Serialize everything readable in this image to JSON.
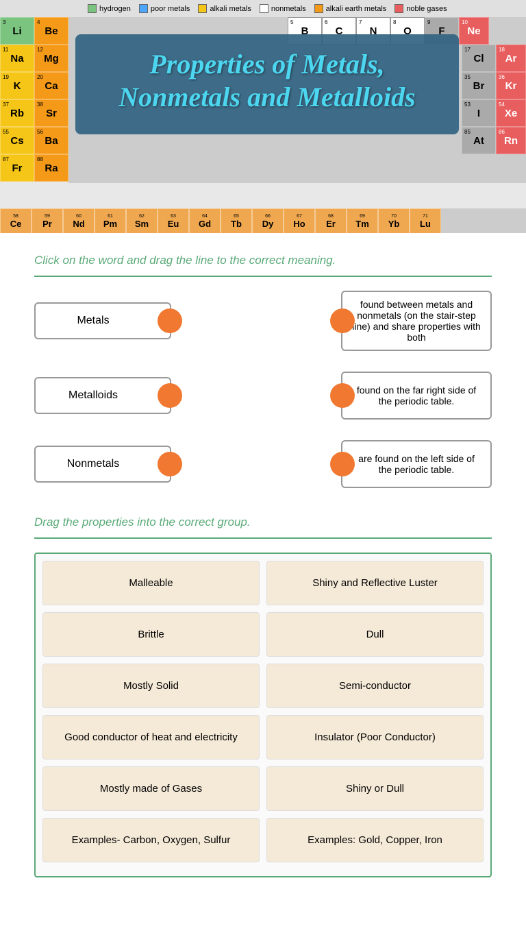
{
  "header": {
    "title": "Properties of Metals, Nonmetals and Metalloids"
  },
  "legend": {
    "items": [
      {
        "label": "hydrogen",
        "color": "#7bc47f",
        "type": "filled"
      },
      {
        "label": "poor metals",
        "color": "#4da6ff",
        "type": "filled"
      },
      {
        "label": "alkali metals",
        "color": "#f5c518",
        "type": "filled"
      },
      {
        "label": "nonmetals",
        "color": "#fff",
        "type": "outlined"
      },
      {
        "label": "alkali earth metals",
        "color": "#f59a18",
        "type": "filled"
      },
      {
        "label": "noble gases",
        "color": "#e85d5d",
        "type": "filled"
      }
    ]
  },
  "instruction1": "Click on the word and drag the line to the correct  meaning.",
  "matches": [
    {
      "term": "Metals",
      "definition": "are found on the left side of the periodic table."
    },
    {
      "term": "Metalloids",
      "definition": "found between metals and nonmetals (on the stair-step line) and share properties with both"
    },
    {
      "term": "Nonmetals",
      "definition": "found on the far right side of the periodic table."
    }
  ],
  "instruction2": "Drag the properties into the correct group.",
  "properties": [
    [
      "Malleable",
      "Shiny and Reflective Luster"
    ],
    [
      "Brittle",
      "Dull"
    ],
    [
      "Mostly Solid",
      "Semi-conductor"
    ],
    [
      "Good conductor of heat and electricity",
      "Insulator (Poor Conductor)"
    ],
    [
      "Mostly made of Gases",
      "Shiny or Dull"
    ],
    [
      "Examples- Carbon, Oxygen, Sulfur",
      "Examples: Gold, Copper, Iron"
    ]
  ],
  "elements": {
    "row1": [
      {
        "num": "3",
        "sym": "Li",
        "type": "alkali"
      },
      {
        "num": "4",
        "sym": "Be",
        "type": "alkali-earth"
      },
      {
        "num": "5",
        "sym": "B",
        "type": "metalloid"
      },
      {
        "num": "6",
        "sym": "C",
        "type": "nonmetal"
      },
      {
        "num": "7",
        "sym": "N",
        "type": "nonmetal"
      },
      {
        "num": "8",
        "sym": "O",
        "type": "nonmetal"
      },
      {
        "num": "9",
        "sym": "F",
        "type": "halogen"
      },
      {
        "num": "10",
        "sym": "Ne",
        "type": "noble"
      }
    ],
    "lanthanides": [
      {
        "num": "58",
        "sym": "Ce"
      },
      {
        "num": "59",
        "sym": "Pr"
      },
      {
        "num": "60",
        "sym": "Nd"
      },
      {
        "num": "61",
        "sym": "Pm"
      },
      {
        "num": "62",
        "sym": "Sm"
      },
      {
        "num": "63",
        "sym": "Eu"
      },
      {
        "num": "64",
        "sym": "Gd"
      },
      {
        "num": "65",
        "sym": "Tb"
      },
      {
        "num": "66",
        "sym": "Dy"
      },
      {
        "num": "67",
        "sym": "Ho"
      },
      {
        "num": "68",
        "sym": "Er"
      },
      {
        "num": "69",
        "sym": "Tm"
      },
      {
        "num": "70",
        "sym": "Yb"
      },
      {
        "num": "71",
        "sym": "Lu"
      }
    ]
  }
}
